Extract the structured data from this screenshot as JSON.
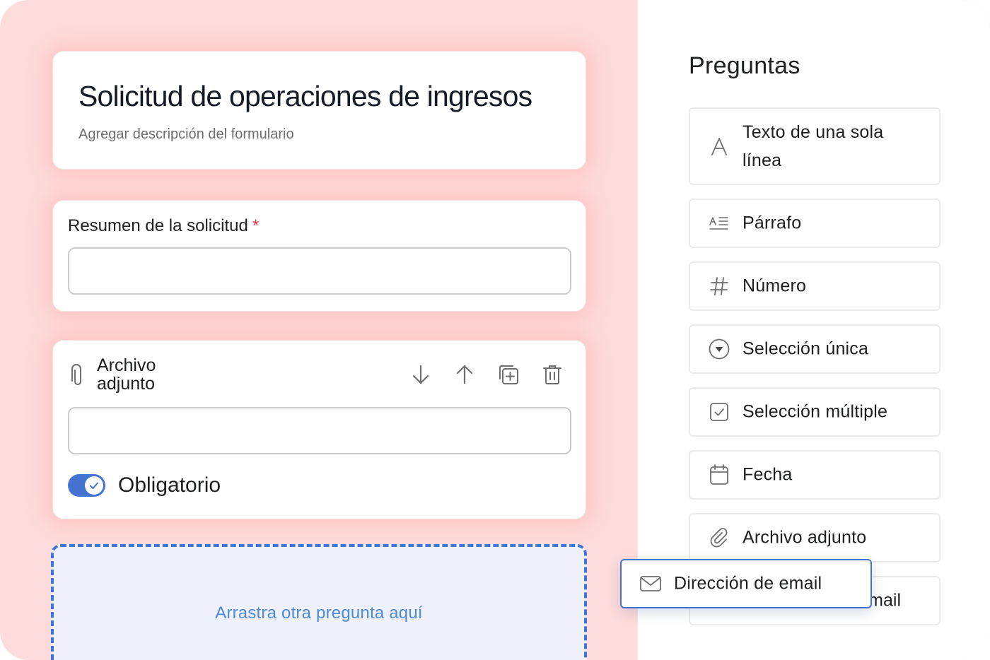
{
  "form": {
    "title": "Solicitud de operaciones de ingresos",
    "description": "Agregar descripción del formulario"
  },
  "questions": [
    {
      "label": "Resumen de la solicitud",
      "required_mark": "*"
    }
  ],
  "attachment_question": {
    "title_line1": "Archivo",
    "title_line2": "adjunto",
    "toolbar_icons": [
      "arrow-down-icon",
      "arrow-up-icon",
      "duplicate-icon",
      "trash-icon"
    ],
    "required_toggle": {
      "label": "Obligatorio",
      "on": true
    }
  },
  "dropzone": {
    "text": "Arrastra otra pregunta aquí"
  },
  "panel": {
    "title": "Preguntas",
    "items": [
      {
        "label": "Texto de una sola línea",
        "icon": "text-a-icon"
      },
      {
        "label": "Párrafo",
        "icon": "paragraph-icon"
      },
      {
        "label": "Número",
        "icon": "hash-icon"
      },
      {
        "label": "Selección única",
        "icon": "dropdown-circle-icon"
      },
      {
        "label": "Selección múltiple",
        "icon": "checkbox-icon"
      },
      {
        "label": "Fecha",
        "icon": "calendar-icon"
      },
      {
        "label": "Archivo adjunto",
        "icon": "paperclip-icon"
      },
      {
        "label_visible": "mail",
        "icon": "envelope-icon"
      }
    ]
  },
  "dragging_item": {
    "label": "Dirección de email",
    "icon": "envelope-icon"
  },
  "colors": {
    "accent": "#4573d2",
    "background": "#fddcdb",
    "required": "#e8384f",
    "dropzone_text": "#4d8bd6"
  }
}
